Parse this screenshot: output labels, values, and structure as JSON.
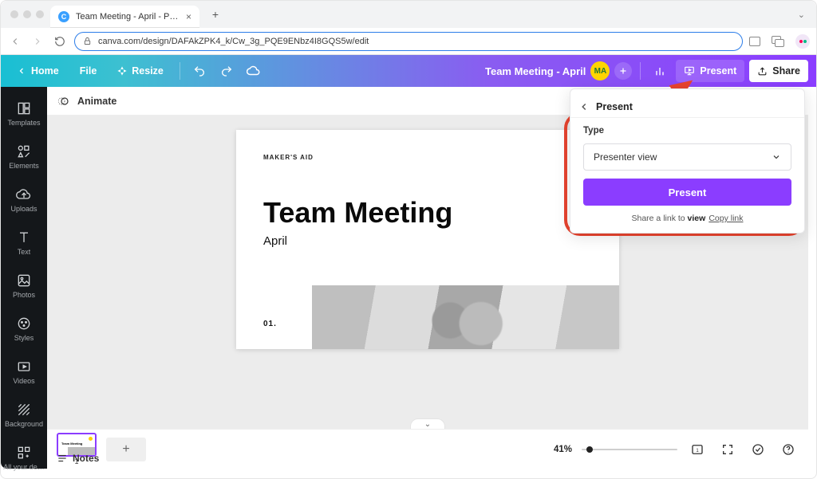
{
  "browser": {
    "tab_title": "Team Meeting - April - Present…",
    "tab_favicon_letter": "C",
    "url": "canva.com/design/DAFAkZPK4_k/Cw_3g_PQE9ENbz4I8GQS5w/edit"
  },
  "topbar": {
    "home": "Home",
    "file": "File",
    "resize": "Resize",
    "doc_title": "Team Meeting - April",
    "avatar_initials": "MA",
    "present": "Present",
    "share": "Share"
  },
  "sidebar": {
    "items": [
      {
        "label": "Templates"
      },
      {
        "label": "Elements"
      },
      {
        "label": "Uploads"
      },
      {
        "label": "Text"
      },
      {
        "label": "Photos"
      },
      {
        "label": "Styles"
      },
      {
        "label": "Videos"
      },
      {
        "label": "Background"
      },
      {
        "label": "All your de…"
      }
    ]
  },
  "subbar": {
    "animate": "Animate"
  },
  "slide": {
    "kicker": "MAKER'S AID",
    "headline": "Team Meeting",
    "subhead": "April",
    "pagenum": "01."
  },
  "thumbs": {
    "first_label": "Team Meeting",
    "first_num": "1"
  },
  "footer": {
    "notes": "Notes",
    "zoom": "41%"
  },
  "popover": {
    "title": "Present",
    "type_label": "Type",
    "select_value": "Presenter view",
    "present_btn": "Present",
    "share_prefix": "Share a link to ",
    "share_bold": "view",
    "copy_link": "Copy link"
  }
}
